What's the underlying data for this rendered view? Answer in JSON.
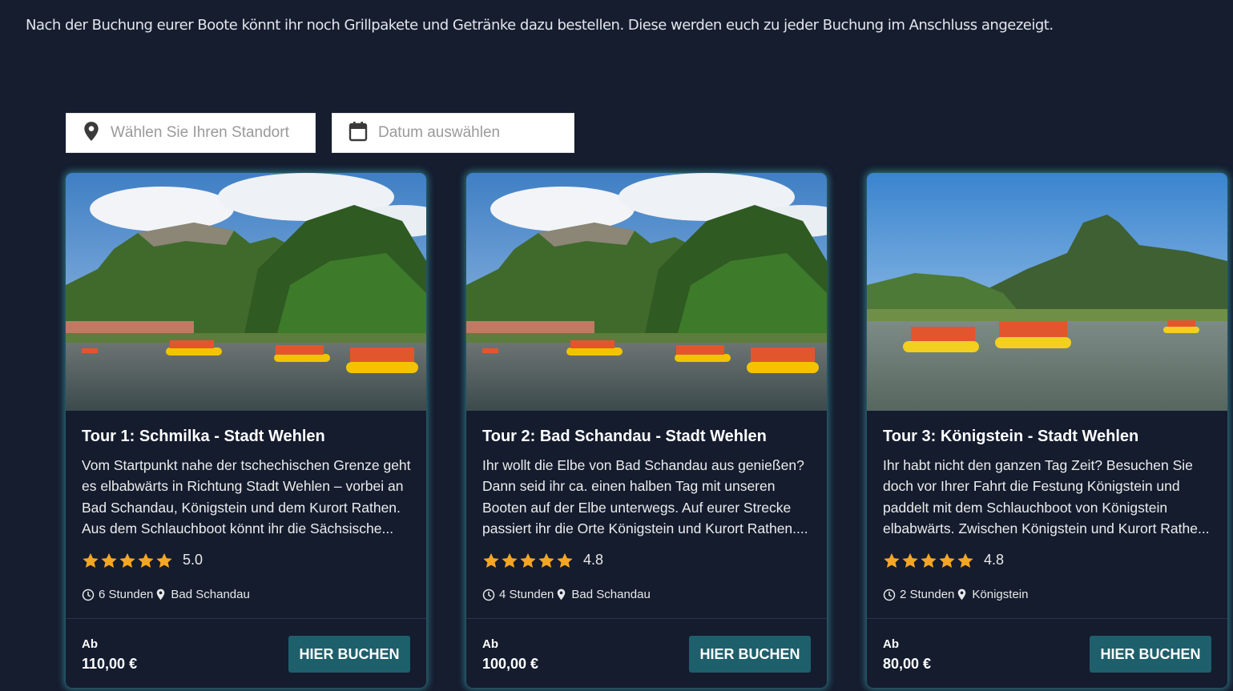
{
  "intro_text": "Nach der Buchung eurer Boote könnt ihr noch Grillpakete und Getränke dazu bestellen. Diese werden euch zu jeder Buchung im Anschluss angezeigt.",
  "filters": {
    "location_placeholder": "Wählen Sie Ihren Standort",
    "date_placeholder": "Datum auswählen",
    "location_icon": "map-pin-icon",
    "date_icon": "calendar-icon"
  },
  "colors": {
    "background": "#151d2f",
    "card_glow": "#46bec8",
    "button": "#1e5f6c",
    "star": "#f5a623"
  },
  "tours": [
    {
      "title": "Tour 1: Schmilka - Stadt Wehlen",
      "description": "Vom Startpunkt nahe der tschechischen Grenze geht es elbabwärts in Richtung Stadt Wehlen – vorbei an Bad Schandau, Königstein und dem Kurort Rathen. Aus dem Schlauchboot könnt ihr die Sächsische...",
      "rating": "5.0",
      "stars": 5,
      "duration": "6 Stunden",
      "location": "Bad Schandau",
      "price_prefix": "Ab",
      "price": "110,00 €",
      "button_label": "HIER BUCHEN"
    },
    {
      "title": "Tour 2: Bad Schandau - Stadt Wehlen",
      "description": "Ihr wollt die Elbe von Bad Schandau aus genießen? Dann seid ihr ca. einen halben Tag mit unseren Booten auf der Elbe unterwegs. Auf eurer Strecke passiert ihr die Orte Königstein und Kurort Rathen....",
      "rating": "4.8",
      "stars": 5,
      "duration": "4 Stunden",
      "location": "Bad Schandau",
      "price_prefix": "Ab",
      "price": "100,00 €",
      "button_label": "HIER BUCHEN"
    },
    {
      "title": "Tour 3: Königstein - Stadt Wehlen",
      "description": "Ihr habt nicht den ganzen Tag Zeit? Besuchen Sie doch vor Ihrer Fahrt die Festung Königstein und paddelt mit dem Schlauchboot von Königstein elbabwärts. Zwischen Königstein und Kurort Rathe...",
      "rating": "4.8",
      "stars": 5,
      "duration": "2 Stunden",
      "location": "Königstein",
      "price_prefix": "Ab",
      "price": "80,00 €",
      "button_label": "HIER BUCHEN"
    }
  ]
}
